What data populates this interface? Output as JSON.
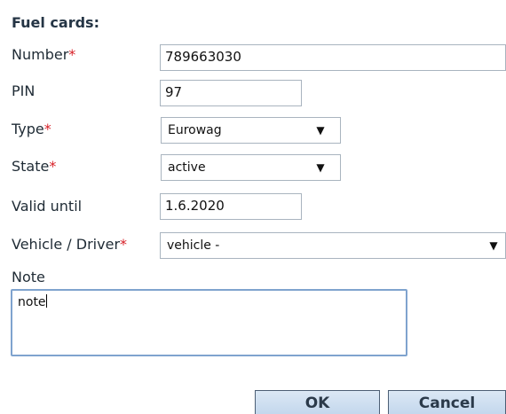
{
  "form": {
    "title": "Fuel cards:",
    "fields": {
      "number": {
        "label": "Number",
        "required_mark": "*",
        "value": "789663030"
      },
      "pin": {
        "label": "PIN",
        "value": "97"
      },
      "type": {
        "label": "Type",
        "required_mark": "*",
        "value": "Eurowag",
        "arrow": "▼"
      },
      "state": {
        "label": "State",
        "required_mark": "*",
        "value": "active",
        "arrow": "▼"
      },
      "valid_until": {
        "label": "Valid until",
        "value": "1.6.2020"
      },
      "vehicle_driver": {
        "label": "Vehicle / Driver",
        "required_mark": "*",
        "value": "vehicle -",
        "arrow": "▼"
      },
      "note": {
        "label": "Note",
        "value": "note"
      }
    },
    "buttons": {
      "ok": "OK",
      "cancel": "Cancel"
    }
  },
  "colors": {
    "required": "#d71f26",
    "input_border": "#a9b4bf",
    "focused_border": "#7fa3ce",
    "button_border": "#4c5f75",
    "button_fill": "#c2d6ec"
  }
}
